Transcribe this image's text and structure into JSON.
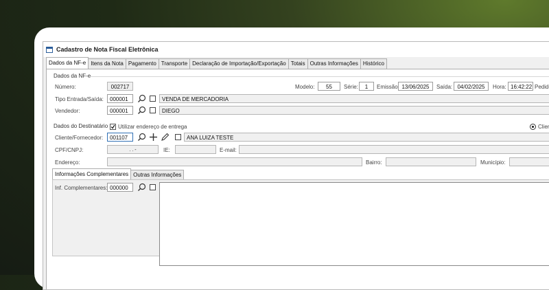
{
  "window": {
    "title": "Cadastro de Nota Fiscal Eletrônica"
  },
  "tabs": [
    "Dados da NF-e",
    "Itens da Nota",
    "Pagamento",
    "Transporte",
    "Declaração de Importação/Exportação",
    "Totais",
    "Outras Informações",
    "Histórico"
  ],
  "nfe": {
    "group_title": "Dados da NF-e",
    "numero_label": "Número:",
    "numero": "002717",
    "modelo_label": "Modelo:",
    "modelo": "55",
    "serie_label": "Série:",
    "serie": "1",
    "emissao_label": "Emissão:",
    "emissao": "13/06/2025",
    "saida_label": "Saída:",
    "saida": "04/02/2025",
    "hora_label": "Hora:",
    "hora": "16:42:22",
    "pedido_label": "Pedido",
    "tipo_label": "Tipo Entrada/Saída:",
    "tipo_code": "000001",
    "tipo_desc": "VENDA DE MERCADORIA",
    "vendedor_label": "Vendedor:",
    "vendedor_code": "000001",
    "vendedor_name": "DIEGO"
  },
  "destinatario": {
    "group_title": "Dados do Destinatário",
    "use_address_label": "Utilizar endereço de entrega",
    "use_address_checked": true,
    "radio_label": "Clien",
    "cliente_label": "Cliente/Fornecedor:",
    "cliente_code": "001107",
    "cliente_name": "ANA LUIZA TESTE",
    "cpf_label": "CPF/CNPJ:",
    "cpf_mask": ". . -",
    "ie_label": "IE:",
    "email_label": "E-mail:",
    "endereco_label": "Endereço:",
    "bairro_label": "Bairro:",
    "municipio_label": "Município:"
  },
  "subtabs": [
    "Informações Complementares",
    "Outras Informações"
  ],
  "complementares": {
    "label": "Inf. Complementares:",
    "code": "000000"
  },
  "colors": {
    "accent_focus": "#2f6fb5",
    "bg_panel": "#f0f0f0"
  }
}
